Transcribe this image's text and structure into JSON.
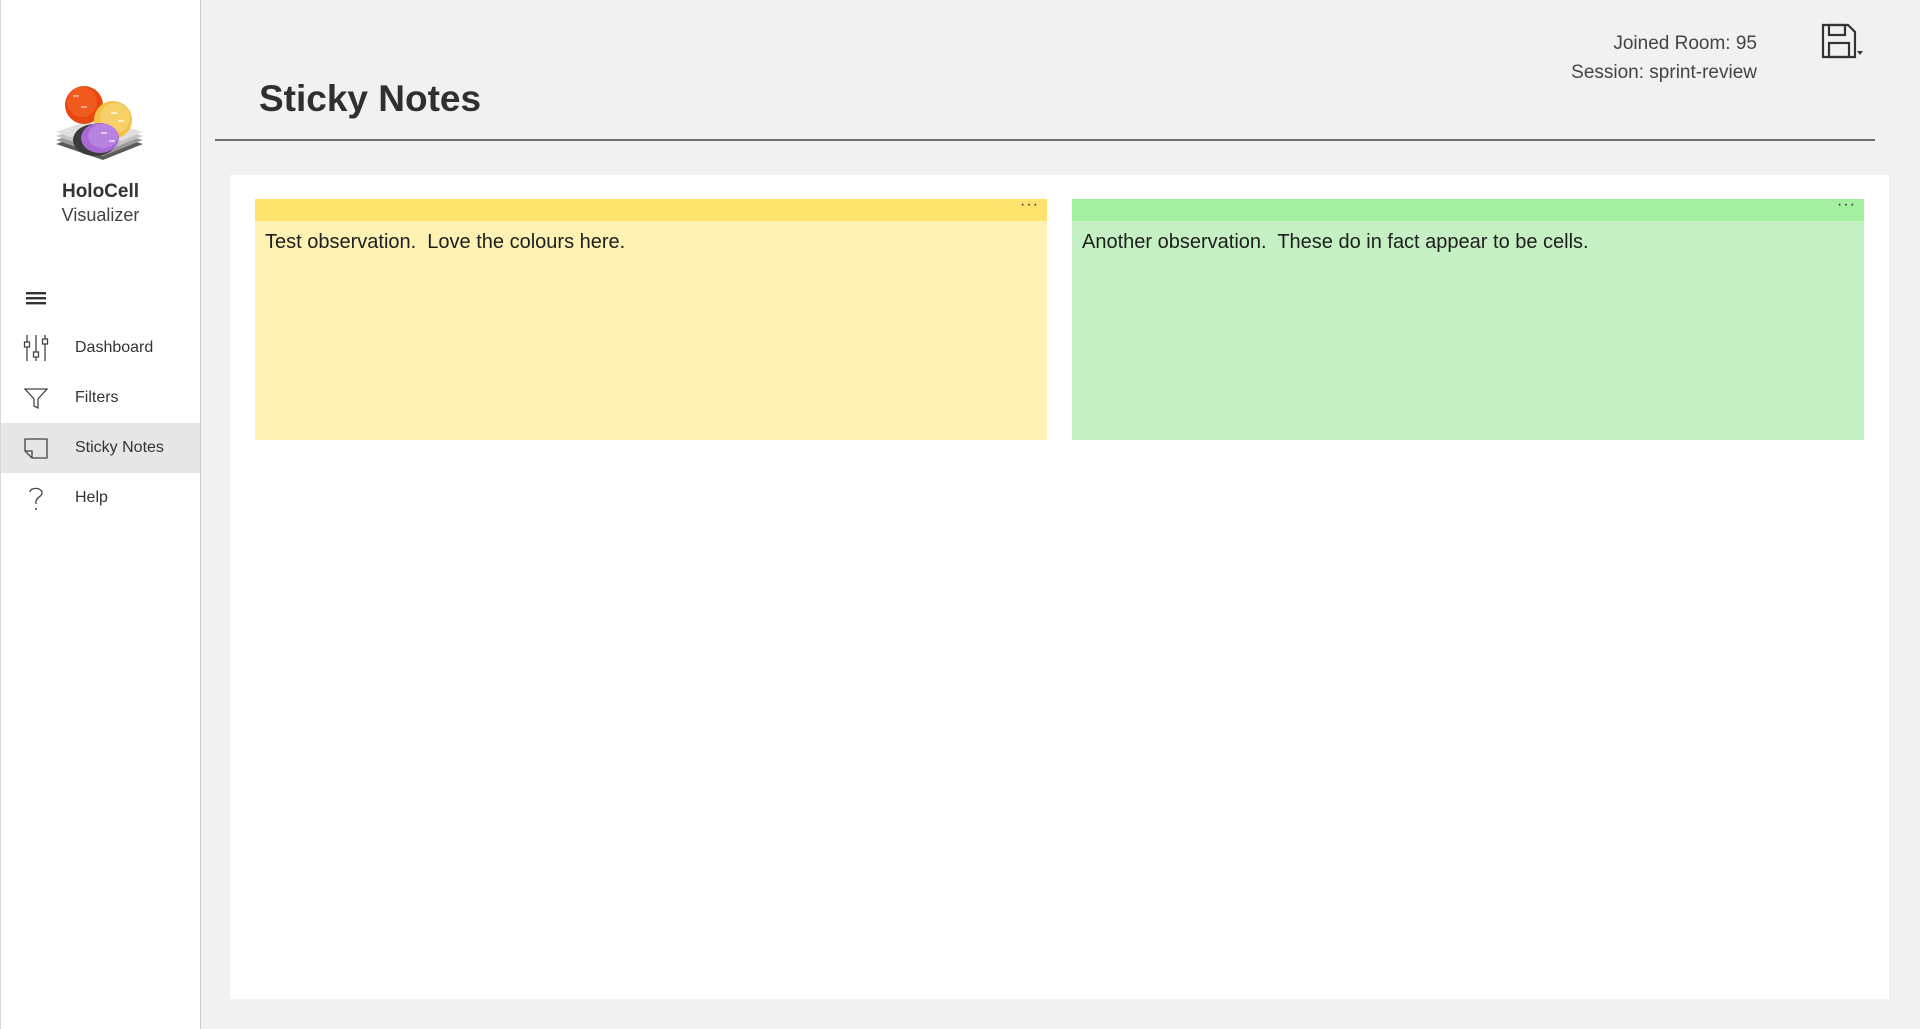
{
  "app": {
    "name": "HoloCell",
    "subtitle": "Visualizer"
  },
  "sidebar": {
    "items": [
      {
        "label": "Dashboard",
        "icon": "sliders-icon"
      },
      {
        "label": "Filters",
        "icon": "filter-icon"
      },
      {
        "label": "Sticky Notes",
        "icon": "sticky-note-icon",
        "active": true
      },
      {
        "label": "Help",
        "icon": "question-icon"
      }
    ]
  },
  "header": {
    "title": "Sticky Notes",
    "room_line": "Joined Room: 95",
    "session_line": "Session: sprint-review"
  },
  "notes": [
    {
      "text": "Test observation.  Love the colours here.",
      "bar_color": "#fde36d",
      "body_color": "#fdf1b4",
      "menu": "···"
    },
    {
      "text": "Another observation.  These do in fact appear to be cells.",
      "bar_color": "#a4f0a0",
      "body_color": "#c5f0c3",
      "menu": "···"
    }
  ]
}
